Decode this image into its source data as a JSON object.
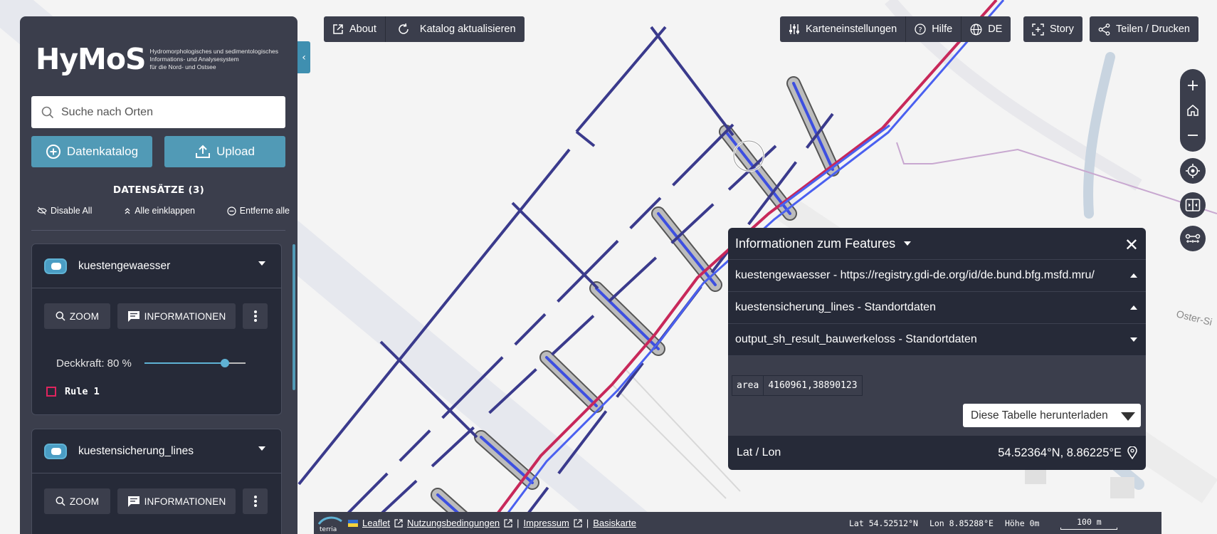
{
  "app": {
    "logo": "HyMoS",
    "logo_subtitle_lines": [
      "Hydromorphologisches und sedimentologisches",
      "Informations- und Analysesystem",
      "für die Nord- und Ostsee"
    ]
  },
  "search": {
    "placeholder": "Suche nach Orten"
  },
  "left_buttons": {
    "catalog": "Datenkatalog",
    "upload": "Upload"
  },
  "datasets": {
    "title": "DATENSÄTZE (3)",
    "actions": {
      "disable_all": "Disable All",
      "collapse_all": "Alle einklappen",
      "remove_all": "Entferne alle"
    }
  },
  "layers": [
    {
      "name": "kuestengewaesser",
      "zoom": "ZOOM",
      "info": "INFORMATIONEN",
      "opacity_label": "Deckkraft: 80 %",
      "opacity": 0.8,
      "rule": "Rule 1"
    },
    {
      "name": "kuestensicherung_lines",
      "zoom": "ZOOM",
      "info": "INFORMATIONEN"
    }
  ],
  "toolbar_left": {
    "about": "About",
    "refresh": "Katalog aktualisieren"
  },
  "toolbar_right": {
    "map_settings": "Karteneinstellungen",
    "help": "Hilfe",
    "language": "DE",
    "story": "Story",
    "share": "Teilen / Drucken"
  },
  "feature_panel": {
    "title": "Informationen zum Features",
    "rows": [
      {
        "label": "kuestengewaesser - https://registry.gdi-de.org/id/de.bund.bfg.msfd.mru/",
        "expanded": true
      },
      {
        "label": "kuestensicherung_lines - Standortdaten",
        "expanded": true
      },
      {
        "label": "output_sh_result_bauwerkeloss - Standortdaten",
        "expanded": false
      }
    ],
    "attr_key": "area",
    "attr_value": "4160961,38890123",
    "download_label": "Diese Tabelle herunterladen",
    "latlon_label": "Lat / Lon",
    "latlon_value": "54.52364°N, 8.86225°E"
  },
  "bottom_bar": {
    "leaflet": "Leaflet",
    "terms": "Nutzungsbedingungen",
    "imprint": "Impressum",
    "basemap": "Basiskarte",
    "lat": "Lat  54.52512°N",
    "lon": "Lon  8.85288°E",
    "height": "Höhe  0m",
    "scale": "100 m",
    "terria": "terria"
  },
  "map_labels": {
    "street": "Oster-Si"
  },
  "colors": {
    "panel": "#3b3e4c",
    "accent": "#519ab6",
    "dark": "#262a38",
    "lines": "#3a3a8c",
    "highlight": "#c8285a"
  }
}
